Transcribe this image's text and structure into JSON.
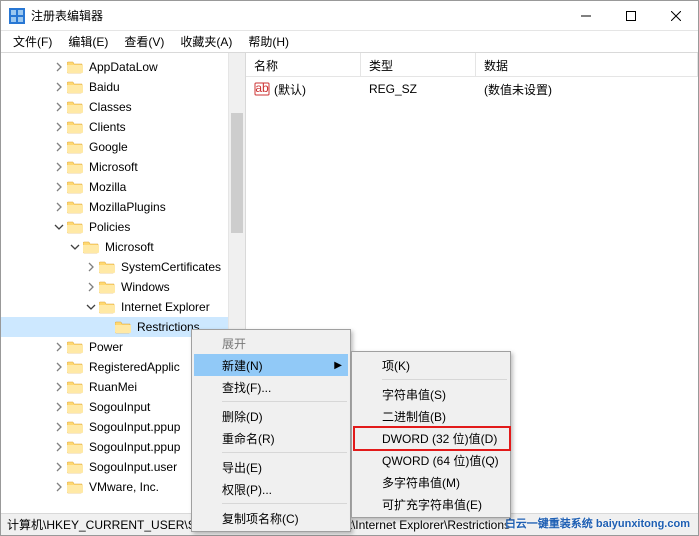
{
  "window": {
    "title": "注册表编辑器"
  },
  "menubar": {
    "file": "文件(F)",
    "edit": "编辑(E)",
    "view": "查看(V)",
    "favorites": "收藏夹(A)",
    "help": "帮助(H)"
  },
  "tree": {
    "items": [
      {
        "indent": 48,
        "exp": "closed",
        "label": "AppDataLow"
      },
      {
        "indent": 48,
        "exp": "closed",
        "label": "Baidu"
      },
      {
        "indent": 48,
        "exp": "closed",
        "label": "Classes"
      },
      {
        "indent": 48,
        "exp": "closed",
        "label": "Clients"
      },
      {
        "indent": 48,
        "exp": "closed",
        "label": "Google"
      },
      {
        "indent": 48,
        "exp": "closed",
        "label": "Microsoft"
      },
      {
        "indent": 48,
        "exp": "closed",
        "label": "Mozilla"
      },
      {
        "indent": 48,
        "exp": "closed",
        "label": "MozillaPlugins"
      },
      {
        "indent": 48,
        "exp": "open",
        "label": "Policies"
      },
      {
        "indent": 64,
        "exp": "open",
        "label": "Microsoft"
      },
      {
        "indent": 80,
        "exp": "closed",
        "label": "SystemCertificates"
      },
      {
        "indent": 80,
        "exp": "closed",
        "label": "Windows"
      },
      {
        "indent": 80,
        "exp": "open",
        "label": "Internet Explorer"
      },
      {
        "indent": 96,
        "exp": "none",
        "label": "Restrictions",
        "selected": true
      },
      {
        "indent": 48,
        "exp": "closed",
        "label": "Power"
      },
      {
        "indent": 48,
        "exp": "closed",
        "label": "RegisteredApplic"
      },
      {
        "indent": 48,
        "exp": "closed",
        "label": "RuanMei"
      },
      {
        "indent": 48,
        "exp": "closed",
        "label": "SogouInput"
      },
      {
        "indent": 48,
        "exp": "closed",
        "label": "SogouInput.ppup"
      },
      {
        "indent": 48,
        "exp": "closed",
        "label": "SogouInput.ppup"
      },
      {
        "indent": 48,
        "exp": "closed",
        "label": "SogouInput.user"
      },
      {
        "indent": 48,
        "exp": "closed",
        "label": "VMware, Inc."
      }
    ]
  },
  "list": {
    "cols": {
      "name": "名称",
      "type": "类型",
      "data": "数据"
    },
    "rows": [
      {
        "name": "(默认)",
        "type": "REG_SZ",
        "data": "(数值未设置)"
      }
    ]
  },
  "context_menu": {
    "items": [
      {
        "label": "展开",
        "disabled": true
      },
      {
        "label": "新建(N)",
        "submenu": true,
        "highlight": true
      },
      {
        "label": "查找(F)..."
      },
      {
        "sep": true
      },
      {
        "label": "删除(D)"
      },
      {
        "label": "重命名(R)"
      },
      {
        "sep": true
      },
      {
        "label": "导出(E)"
      },
      {
        "label": "权限(P)..."
      },
      {
        "sep": true
      },
      {
        "label": "复制项名称(C)"
      }
    ],
    "submenu": [
      {
        "label": "项(K)"
      },
      {
        "sep": true
      },
      {
        "label": "字符串值(S)"
      },
      {
        "label": "二进制值(B)"
      },
      {
        "label": "DWORD (32 位)值(D)",
        "redbox": true
      },
      {
        "label": "QWORD (64 位)值(Q)"
      },
      {
        "label": "多字符串值(M)"
      },
      {
        "label": "可扩充字符串值(E)"
      }
    ]
  },
  "statusbar": {
    "path": "计算机\\HKEY_CURRENT_USER\\SOFTWARE\\Policies\\Microsoft\\Internet Explorer\\Restrictions"
  },
  "watermark": "白云一键重装系统 baiyunxitong.com"
}
